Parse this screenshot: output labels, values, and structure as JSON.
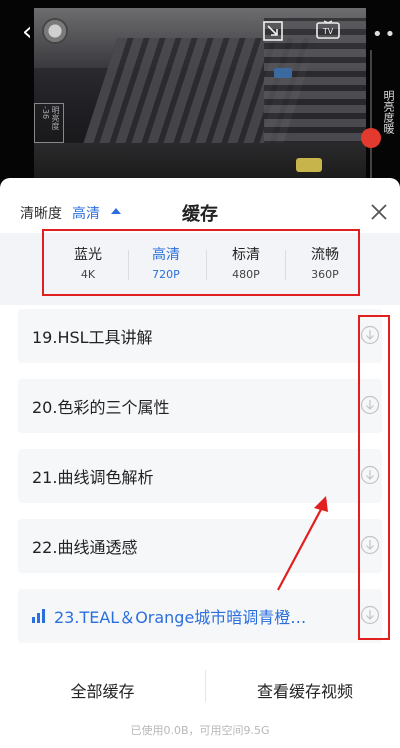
{
  "video": {
    "brightness_label": "明亮度暖",
    "exposure_label": "明亮度 -36"
  },
  "header": {
    "resolution_label": "清晰度",
    "resolution_value": "高清",
    "title": "缓存"
  },
  "quality_options": [
    {
      "name": "蓝光",
      "sub": "4K",
      "active": false
    },
    {
      "name": "高清",
      "sub": "720P",
      "active": true
    },
    {
      "name": "标清",
      "sub": "480P",
      "active": false
    },
    {
      "name": "流畅",
      "sub": "360P",
      "active": false
    }
  ],
  "episodes": [
    {
      "title": "19.HSL工具讲解",
      "playing": false
    },
    {
      "title": "20.色彩的三个属性",
      "playing": false
    },
    {
      "title": "21.曲线调色解析",
      "playing": false
    },
    {
      "title": "22.曲线通透感",
      "playing": false
    },
    {
      "title": "23.TEAL＆Orange城市暗调青橙…",
      "playing": true
    }
  ],
  "footer": {
    "cache_all": "全部缓存",
    "view_cached": "查看缓存视频",
    "storage": "已使用0.0B，可用空间9.5G"
  },
  "colors": {
    "accent": "#2b6fde",
    "annotation": "#e11f1f"
  }
}
